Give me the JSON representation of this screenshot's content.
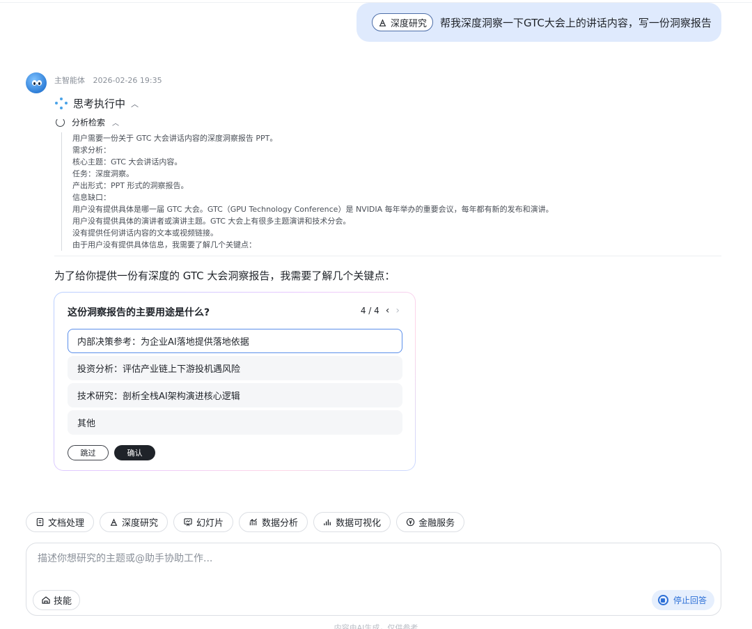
{
  "user_message": {
    "tag": "深度研究",
    "text": "帮我深度洞察一下GTC大会上的讲话内容，写一份洞察报告"
  },
  "agent": {
    "name": "主智能体",
    "timestamp": "2026-02-26 19:35",
    "thinking_label": "思考执行中",
    "step_label": "分析检索",
    "reasoning_lines": [
      "用户需要一份关于 GTC 大会讲话内容的深度洞察报告 PPT。",
      "需求分析：",
      "核心主题：GTC 大会讲话内容。",
      "任务：深度洞察。",
      "产出形式：PPT 形式的洞察报告。",
      "信息缺口：",
      "用户没有提供具体是哪一届 GTC 大会。GTC（GPU Technology Conference）是 NVIDIA 每年举办的重要会议，每年都有新的发布和演讲。",
      "用户没有提供具体的演讲者或演讲主题。GTC 大会上有很多主题演讲和技术分会。",
      "没有提供任何讲话内容的文本或视频链接。",
      "由于用户没有提供具体信息，我需要了解几个关键点："
    ],
    "answer_lead": "为了给你提供一份有深度的 GTC 大会洞察报告，我需要了解几个关键点："
  },
  "question_card": {
    "question": "这份洞察报告的主要用途是什么?",
    "pager": "4 / 4",
    "options": [
      "内部决策参考：为企业AI落地提供落地依据",
      "投资分析：评估产业链上下游投机遇风险",
      "技术研究：剖析全栈AI架构演进核心逻辑",
      "其他"
    ],
    "selected_index": 0,
    "skip_label": "跳过",
    "confirm_label": "确认"
  },
  "tool_chips": [
    {
      "label": "文档处理",
      "icon": "document-icon"
    },
    {
      "label": "深度研究",
      "icon": "research-icon"
    },
    {
      "label": "幻灯片",
      "icon": "slides-icon"
    },
    {
      "label": "数据分析",
      "icon": "analysis-icon"
    },
    {
      "label": "数据可视化",
      "icon": "chart-icon"
    },
    {
      "label": "金融服务",
      "icon": "finance-icon"
    }
  ],
  "composer": {
    "placeholder": "描述你想研究的主题或@助手协助工作...",
    "skill_label": "技能",
    "stop_label": "停止回答"
  },
  "footer_note": "内容由AI生成，仅供参考",
  "colors": {
    "user_bubble": "#dfeafd",
    "accent_blue": "#2c6fd6",
    "selected_border": "#5a8eea",
    "confirm_bg": "#1f2329"
  }
}
